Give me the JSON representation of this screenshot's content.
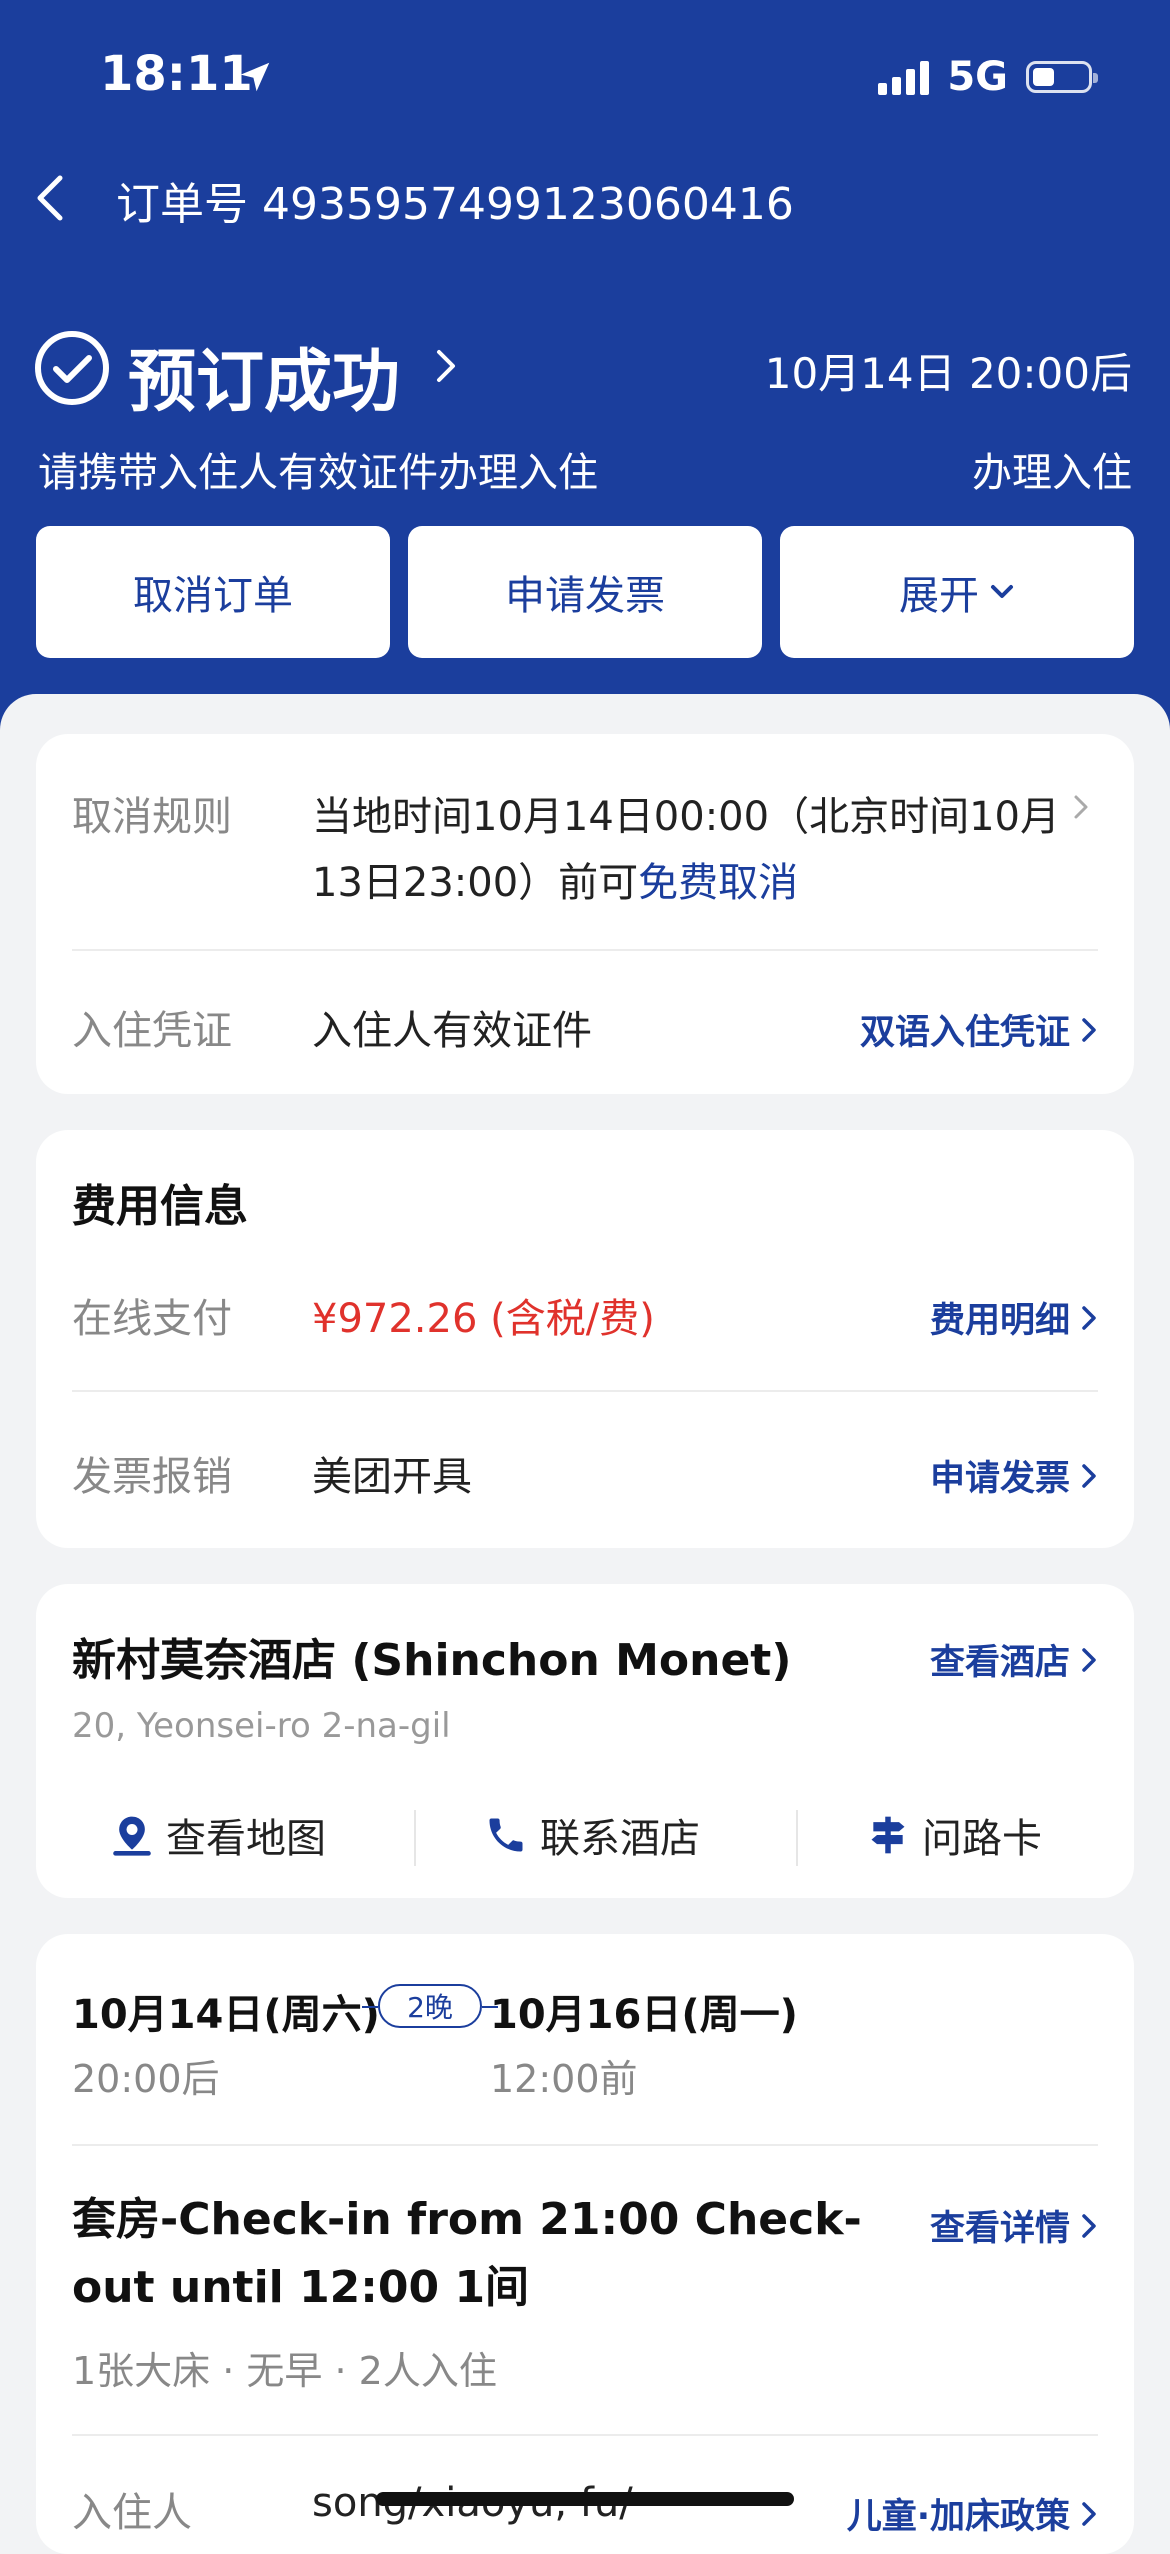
{
  "status_bar": {
    "time": "18:11",
    "network": "5G",
    "battery_level": 0.4
  },
  "nav": {
    "order_number": "订单号 4935957499123060416"
  },
  "status": {
    "title": "预订成功",
    "checkin_time": "10月14日 20:00后",
    "subtitle": "请携带入住人有效证件办理入住",
    "checkin_label": "办理入住"
  },
  "actions": {
    "cancel": "取消订单",
    "invoice": "申请发票",
    "expand": "展开"
  },
  "policy": {
    "cancel_label": "取消规则",
    "cancel_text_1": "当地时间10月14日00:00（北京时间10月",
    "cancel_text_2": "13日23:00）前可",
    "cancel_link": "免费取消",
    "voucher_label": "入住凭证",
    "voucher_value": "入住人有效证件",
    "voucher_link": "双语入住凭证"
  },
  "fee": {
    "title": "费用信息",
    "online_label": "在线支付",
    "online_value": "¥972.26 (含税/费)",
    "detail_link": "费用明细",
    "invoice_label": "发票报销",
    "invoice_value": "美团开具",
    "invoice_link": "申请发票"
  },
  "hotel": {
    "name": "新村莫奈酒店 (Shinchon Monet)",
    "address": "20, Yeonsei-ro 2-na-gil",
    "view_link": "查看酒店",
    "map": "查看地图",
    "contact": "联系酒店",
    "direction": "问路卡"
  },
  "stay": {
    "checkin_date": "10月14日(周六)",
    "checkin_time": "20:00后",
    "nights": "2晚",
    "checkout_date": "10月16日(周一)",
    "checkout_time": "12:00前",
    "room_line1": "套房-Check-in from 21:00 Check-",
    "room_line2": "out until 12:00 1间",
    "room_detail_link": "查看详情",
    "room_features": "1张大床 · 无早 · 2人入住",
    "guest_label": "入住人",
    "guest_value": "song/xiaoyu, fu/",
    "policy_link": "儿童·加床政策"
  },
  "colors": {
    "brand": "#1b3e9d",
    "price": "#e0322c",
    "background": "#f2f3f5"
  }
}
